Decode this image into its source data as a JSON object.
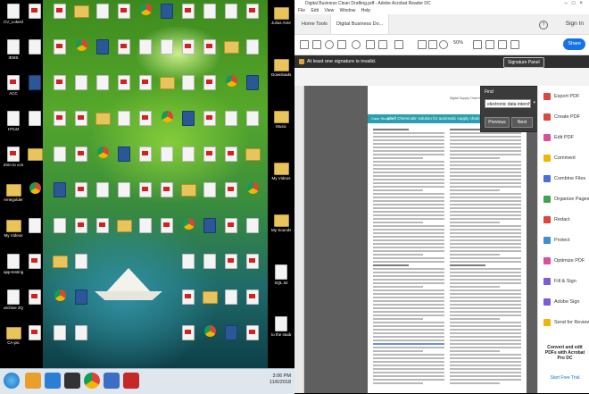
{
  "desktop": {
    "icons": [
      {
        "label": "CV_Lokesh Amegolden...",
        "kind": "doc"
      },
      {
        "label": "IEMS",
        "kind": "doc"
      },
      {
        "label": "ACC",
        "kind": "pdf"
      },
      {
        "label": "HTLM",
        "kind": "doc"
      },
      {
        "label": "intro to computer...",
        "kind": "pdf"
      },
      {
        "label": "Amegolden Julius Aku...",
        "kind": "folder"
      },
      {
        "label": "My Videos",
        "kind": "folder"
      },
      {
        "label": "app-testing",
        "kind": "doc"
      },
      {
        "label": "archive 2Q",
        "kind": "doc"
      },
      {
        "label": "CA-pic",
        "kind": "folder"
      }
    ],
    "right_icons": [
      {
        "label": "Julius Amegolden",
        "kind": "folder"
      },
      {
        "label": "Downloads",
        "kind": "folder"
      },
      {
        "label": "Music",
        "kind": "folder"
      },
      {
        "label": "My Videos",
        "kind": "folder"
      },
      {
        "label": "My Sounds",
        "kind": "folder"
      },
      {
        "label": "SQL.txt",
        "kind": "doc"
      },
      {
        "label": "to the student",
        "kind": "doc"
      }
    ]
  },
  "taskbar": {
    "time": "3:06 PM",
    "date": "11/6/2018"
  },
  "acrobat": {
    "window_title": "Digital Business Clean Drafting.pdf - Adobe Acrobat Reader DC",
    "menu": [
      "File",
      "Edit",
      "View",
      "Window",
      "Help"
    ],
    "tabs": {
      "home": "Home",
      "tools": "Tools",
      "doc": "Digital Business Do..."
    },
    "sign_in": "Sign In",
    "zoom": "50%",
    "share": "Share",
    "signature_msg": "At least one signature is invalid.",
    "signature_panel": "Signature Panel",
    "find": {
      "title": "Find",
      "query": "electronic data interchange",
      "prev": "Previous",
      "next": "Next"
    },
    "page": {
      "case_label": "Case Study 3",
      "banner": "Shell Chemicals' solution for automatic supply chain",
      "journal": "Digital Supply Chain Management"
    },
    "tools": [
      {
        "label": "Export PDF",
        "color": "#e0443c"
      },
      {
        "label": "Create PDF",
        "color": "#e0443c"
      },
      {
        "label": "Edit PDF",
        "color": "#d94f9a"
      },
      {
        "label": "Comment",
        "color": "#f2b400"
      },
      {
        "label": "Combine Files",
        "color": "#4c6fd6"
      },
      {
        "label": "Organize Pages",
        "color": "#3fa34d"
      },
      {
        "label": "Redact",
        "color": "#e0443c"
      },
      {
        "label": "Protect",
        "color": "#3d8fd6"
      },
      {
        "label": "Optimize PDF",
        "color": "#d94f9a"
      },
      {
        "label": "Fill & Sign",
        "color": "#7b5cd6"
      },
      {
        "label": "Adobe Sign",
        "color": "#7b5cd6"
      },
      {
        "label": "Send for Review",
        "color": "#f2b400"
      }
    ],
    "promo": "Convert and edit PDFs with Acrobat Pro DC",
    "free_trial": "Start Free Trial"
  }
}
